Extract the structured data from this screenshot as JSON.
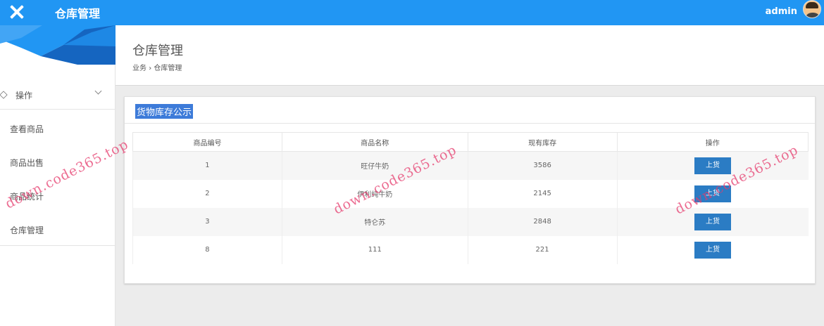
{
  "header": {
    "title": "仓库管理",
    "username": "admin"
  },
  "sidebar": {
    "group": {
      "label": "操作"
    },
    "items": [
      {
        "label": "查看商品"
      },
      {
        "label": "商品出售"
      },
      {
        "label": "商品统计"
      },
      {
        "label": "仓库管理"
      }
    ]
  },
  "page": {
    "title": "仓库管理",
    "breadcrumb": [
      "业务",
      "仓库管理"
    ],
    "breadcrumb_separator": "›"
  },
  "panel": {
    "title": "货物库存公示",
    "columns": [
      "商品编号",
      "商品名称",
      "现有库存",
      "操作"
    ],
    "rows": [
      {
        "id": "1",
        "name": "旺仔牛奶",
        "stock": "3586",
        "action": "上货"
      },
      {
        "id": "2",
        "name": "伊利纯牛奶",
        "stock": "2145",
        "action": "上货"
      },
      {
        "id": "3",
        "name": "特仑苏",
        "stock": "2848",
        "action": "上货"
      },
      {
        "id": "8",
        "name": "111",
        "stock": "221",
        "action": "上货"
      }
    ]
  },
  "watermark": {
    "text": "down.code365.top"
  },
  "colors": {
    "topbar": "#2196f3",
    "button": "#2b7cc4",
    "panel_title_highlight": "#3d7bd9",
    "watermark": "#e63c6e"
  }
}
